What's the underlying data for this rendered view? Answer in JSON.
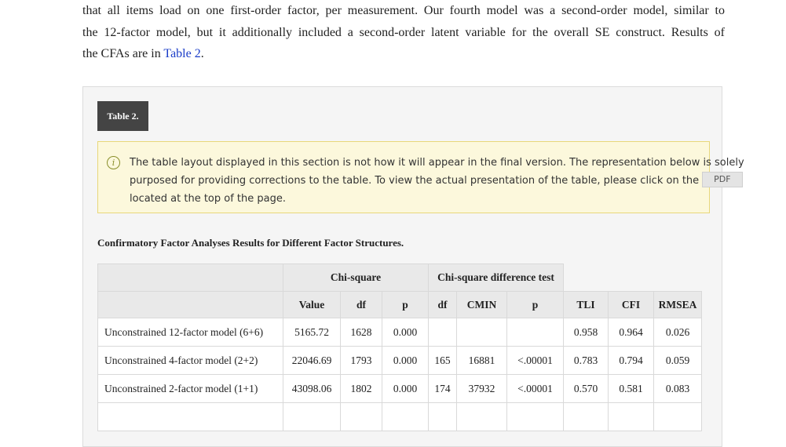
{
  "body_paragraph": {
    "line1": "that all items load on one first-order factor, per measurement. Our fourth model was a second-order model, similar to",
    "line2": "the 12-factor model, but it additionally included a second-order latent variable for the overall SE construct. Results of",
    "line3_before": "the CFAs are in ",
    "line3_link": "Table 2",
    "line3_after": "."
  },
  "table_badge": "Table 2.",
  "notice": {
    "icon": "info-icon",
    "line1": "The table layout displayed in this section is not how it will appear in the final version. The representation below is solely",
    "line2": "purposed for providing corrections to the table. To view the actual presentation of the table, please click on the",
    "pdf_label": "PDF",
    "line3": "located at the top of the page."
  },
  "caption": "Confirmatory Factor Analyses Results for Different Factor Structures.",
  "table": {
    "group_headers": {
      "chi_square": "Chi-square",
      "chi_square_diff": "Chi-square difference test"
    },
    "columns": [
      "Value",
      "df",
      "p",
      "df",
      "CMIN",
      "p",
      "TLI",
      "CFI",
      "RMSEA"
    ],
    "rows": [
      {
        "label": "Unconstrained 12-factor model (6+6)",
        "cells": [
          "5165.72",
          "1628",
          "0.000",
          "",
          "",
          "",
          "0.958",
          "0.964",
          "0.026"
        ]
      },
      {
        "label": "Unconstrained 4-factor model (2+2)",
        "cells": [
          "22046.69",
          "1793",
          "0.000",
          "165",
          "16881",
          "<.00001",
          "0.783",
          "0.794",
          "0.059"
        ]
      },
      {
        "label": "Unconstrained 2-factor model (1+1)",
        "cells": [
          "43098.06",
          "1802",
          "0.000",
          "174",
          "37932",
          "<.00001",
          "0.570",
          "0.581",
          "0.083"
        ]
      },
      {
        "label": "",
        "cells": [
          "",
          "",
          "",
          "",
          "",
          "",
          "",
          "",
          ""
        ]
      }
    ]
  }
}
